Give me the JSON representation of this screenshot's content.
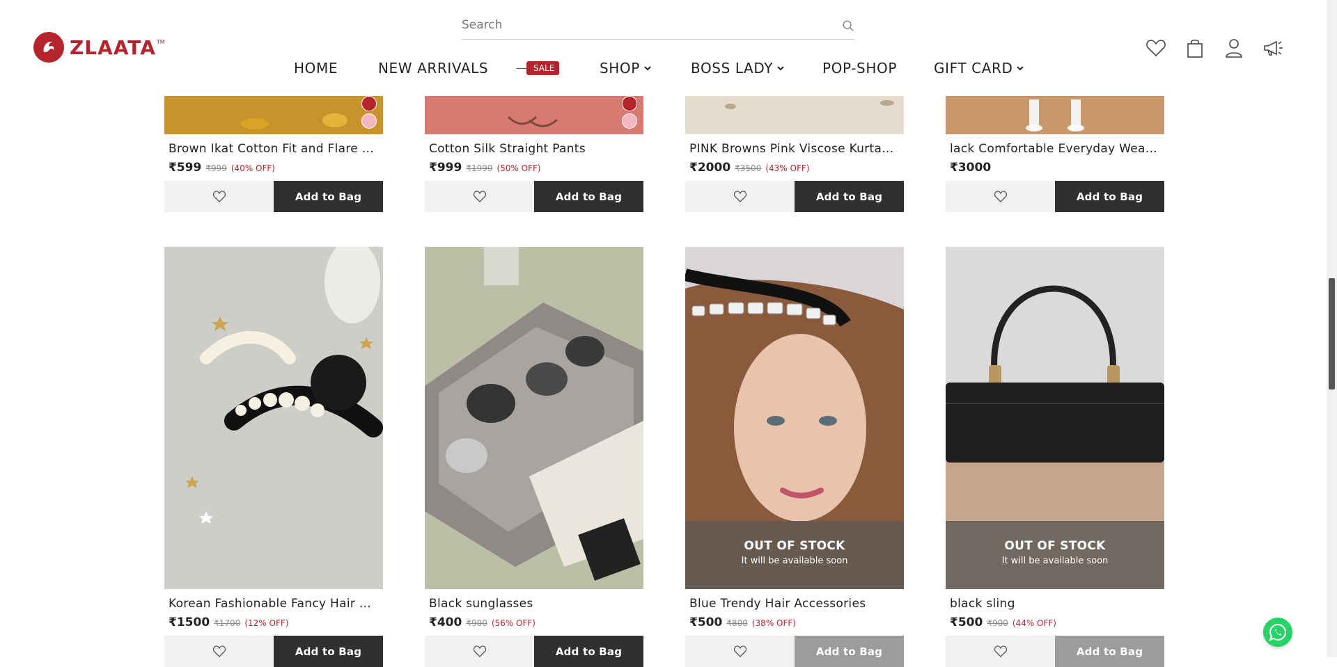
{
  "brand": {
    "name": "ZLAATA",
    "tm": "TM",
    "color": "#b5232d"
  },
  "search": {
    "placeholder": "Search"
  },
  "nav": {
    "home": "HOME",
    "new_arrivals": "NEW ARRIVALS",
    "sale_tag": "SALE",
    "shop": "SHOP",
    "boss_lady": "BOSS LADY",
    "pop_shop": "POP-SHOP",
    "gift_card": "GIFT CARD"
  },
  "header_icons": [
    "heart-icon",
    "bag-icon",
    "user-icon",
    "megaphone-icon"
  ],
  "products_row1": [
    {
      "title": "Brown Ikat Cotton Fit and Flare Ma...",
      "price": "₹599",
      "mrp": "₹999",
      "off": "(40% OFF)",
      "bag_label": "Add to Bag",
      "bg": "#c8932a",
      "swatches": [
        "#b5232d",
        "#f4b6c2"
      ]
    },
    {
      "title": "Cotton Silk Straight Pants",
      "price": "₹999",
      "mrp": "₹1999",
      "off": "(50% OFF)",
      "bag_label": "Add to Bag",
      "bg": "#d97a72",
      "swatches": [
        "#b5232d",
        "#f4b6c2"
      ]
    },
    {
      "title": "PINK Browns Pink Viscose Kurta...",
      "price": "₹2000",
      "mrp": "₹3500",
      "off": "(43% OFF)",
      "bag_label": "Add to Bag",
      "bg": "#e5dccd",
      "swatches": []
    },
    {
      "title": "lack Comfortable Everyday Wear fo...",
      "price": "₹3000",
      "mrp": "",
      "off": "",
      "bag_label": "Add to Bag",
      "bg": "#c8976a",
      "swatches": []
    }
  ],
  "products_row2": [
    {
      "title": "Korean Fashionable Fancy Hair Cla...",
      "price": "₹1500",
      "mrp": "₹1700",
      "off": "(12% OFF)",
      "bag_label": "Add to Bag",
      "bg": "#cfcfcf",
      "out_of_stock": false
    },
    {
      "title": "Black sunglasses",
      "price": "₹400",
      "mrp": "₹900",
      "off": "(56% OFF)",
      "bag_label": "Add to Bag",
      "bg": "#b9bba3",
      "out_of_stock": false
    },
    {
      "title": "Blue Trendy Hair Accessories",
      "price": "₹500",
      "mrp": "₹800",
      "off": "(38% OFF)",
      "bag_label": "Add to Bag",
      "bg": "#d7d3d6",
      "out_of_stock": true
    },
    {
      "title": "black sling",
      "price": "₹500",
      "mrp": "₹900",
      "off": "(44% OFF)",
      "bag_label": "Add to Bag",
      "bg": "#d9d9d9",
      "out_of_stock": true
    }
  ],
  "oos": {
    "title": "OUT OF STOCK",
    "subtitle": "It will be available soon"
  }
}
